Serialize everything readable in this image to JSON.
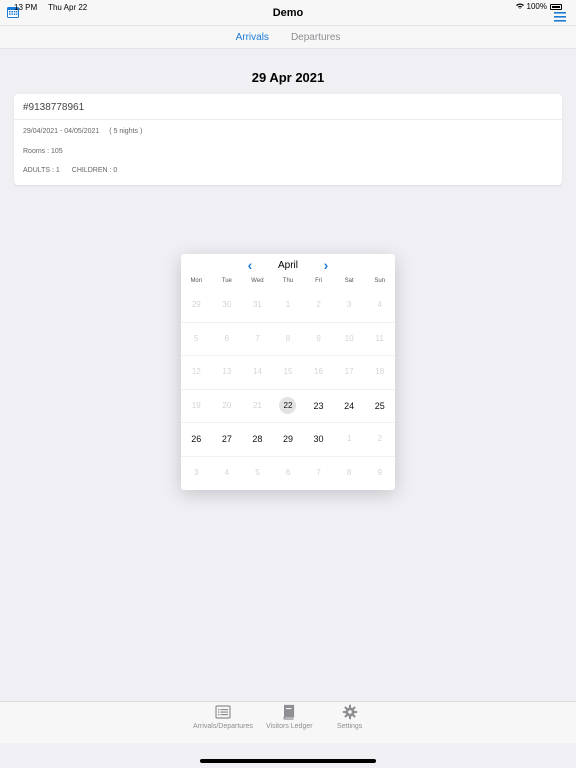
{
  "status_bar": {
    "time": "13 PM",
    "date": "Thu Apr 22",
    "battery": "100%"
  },
  "nav": {
    "title": "Demo"
  },
  "segments": {
    "arrivals": "Arrivals",
    "departures": "Departures"
  },
  "main": {
    "date_heading": "29 Apr 2021",
    "booking": {
      "id": "#9138778961",
      "dates": "29/04/2021 - 04/05/2021",
      "nights": "( 5 nights )",
      "rooms": "Rooms : 105",
      "adults": "ADULTS : 1",
      "children": "CHILDREN : 0"
    }
  },
  "calendar": {
    "month": "April",
    "weekdays": [
      "Mon",
      "Tue",
      "Wed",
      "Thu",
      "Fri",
      "Sat",
      "Sun"
    ],
    "today": "22",
    "weeks": [
      [
        {
          "d": "29",
          "a": false
        },
        {
          "d": "30",
          "a": false
        },
        {
          "d": "31",
          "a": false
        },
        {
          "d": "1",
          "a": false
        },
        {
          "d": "2",
          "a": false
        },
        {
          "d": "3",
          "a": false
        },
        {
          "d": "4",
          "a": false
        }
      ],
      [
        {
          "d": "5",
          "a": false
        },
        {
          "d": "6",
          "a": false
        },
        {
          "d": "7",
          "a": false
        },
        {
          "d": "8",
          "a": false
        },
        {
          "d": "9",
          "a": false
        },
        {
          "d": "10",
          "a": false
        },
        {
          "d": "11",
          "a": false
        }
      ],
      [
        {
          "d": "12",
          "a": false
        },
        {
          "d": "13",
          "a": false
        },
        {
          "d": "14",
          "a": false
        },
        {
          "d": "15",
          "a": false
        },
        {
          "d": "16",
          "a": false
        },
        {
          "d": "17",
          "a": false
        },
        {
          "d": "18",
          "a": false
        }
      ],
      [
        {
          "d": "19",
          "a": false
        },
        {
          "d": "20",
          "a": false
        },
        {
          "d": "21",
          "a": false
        },
        {
          "d": "22",
          "a": true
        },
        {
          "d": "23",
          "a": true
        },
        {
          "d": "24",
          "a": true
        },
        {
          "d": "25",
          "a": true
        }
      ],
      [
        {
          "d": "26",
          "a": true
        },
        {
          "d": "27",
          "a": true
        },
        {
          "d": "28",
          "a": true
        },
        {
          "d": "29",
          "a": true
        },
        {
          "d": "30",
          "a": true
        },
        {
          "d": "1",
          "a": false
        },
        {
          "d": "2",
          "a": false
        }
      ],
      [
        {
          "d": "3",
          "a": false
        },
        {
          "d": "4",
          "a": false
        },
        {
          "d": "5",
          "a": false
        },
        {
          "d": "6",
          "a": false
        },
        {
          "d": "7",
          "a": false
        },
        {
          "d": "8",
          "a": false
        },
        {
          "d": "9",
          "a": false
        }
      ]
    ]
  },
  "tab_bar": {
    "arrivals_departures": "Arrivals/Departures",
    "visitors_ledger": "Visitors Ledger",
    "settings": "Settings"
  },
  "colors": {
    "accent": "#1a7bd6",
    "background": "#efeff4",
    "inactive": "#8e8e93"
  }
}
